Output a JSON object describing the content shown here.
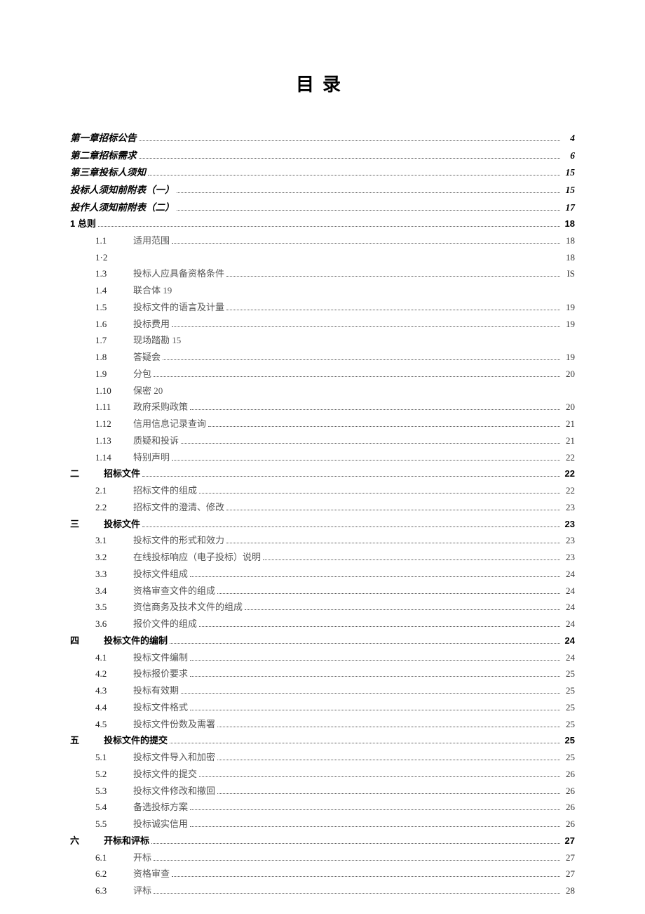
{
  "title": "目录",
  "entries": [
    {
      "level": 0,
      "style": "italic",
      "num": "",
      "label": "第一章招标公告",
      "page": "4",
      "dots": true
    },
    {
      "level": 0,
      "style": "italic",
      "num": "",
      "label": "第二章招标需求",
      "page": "6",
      "dots": true
    },
    {
      "level": 0,
      "style": "italic",
      "num": "",
      "label": "第三章投标人须知",
      "page": "15",
      "dots": true
    },
    {
      "level": 0,
      "style": "italic",
      "num": "",
      "label": "投标人须知前附表（一）",
      "page": "15",
      "dots": true
    },
    {
      "level": 0,
      "style": "italic",
      "num": "",
      "label": "投作人须知前附表（二）",
      "page": "17",
      "dots": true
    },
    {
      "level": 0,
      "style": "bold",
      "num": "",
      "label": "1 总则",
      "page": "18",
      "dots": true
    },
    {
      "level": 2,
      "num": "1.1",
      "label": "适用范围",
      "page": "18",
      "dots": true
    },
    {
      "level": 2,
      "num": "1·2",
      "label": "",
      "page": "18",
      "dots": false,
      "pageRight": true
    },
    {
      "level": 2,
      "num": "1.3",
      "label": "投标人应具备资格条件",
      "page": "IS",
      "dots": true
    },
    {
      "level": 2,
      "num": "1.4",
      "label": "联合体 19",
      "page": "",
      "dots": false
    },
    {
      "level": 2,
      "num": "1.5",
      "label": "投标文件的语言及计量",
      "page": "19",
      "dots": true
    },
    {
      "level": 2,
      "num": "1.6",
      "label": "投标费用",
      "page": "19",
      "dots": true
    },
    {
      "level": 2,
      "num": "1.7",
      "label": "现场踏勘 15",
      "page": "",
      "dots": false
    },
    {
      "level": 2,
      "num": "1.8",
      "label": "答疑会",
      "page": "19",
      "dots": true
    },
    {
      "level": 2,
      "num": "1.9",
      "label": "分包",
      "page": "20",
      "dots": true
    },
    {
      "level": 2,
      "num": "1.10",
      "label": "保密 20",
      "page": "",
      "dots": false
    },
    {
      "level": 2,
      "num": "1.11",
      "label": "政府采购政策",
      "page": "20",
      "dots": true
    },
    {
      "level": 2,
      "num": "1.12",
      "label": "信用信息记录查询",
      "page": "21",
      "dots": true
    },
    {
      "level": 2,
      "num": "1.13",
      "label": "质疑和投诉",
      "page": "21",
      "dots": true
    },
    {
      "level": 2,
      "num": "1.14",
      "label": "特别声明",
      "page": "22",
      "dots": true
    },
    {
      "level": 1,
      "style": "bold",
      "num": "二",
      "label": "招标文件",
      "page": "22",
      "dots": true
    },
    {
      "level": 2,
      "num": "2.1",
      "label": "招标文件的组成",
      "page": "22",
      "dots": true
    },
    {
      "level": 2,
      "num": "2.2",
      "label": "招标文件的澄清、修改",
      "page": "23",
      "dots": true
    },
    {
      "level": 1,
      "style": "bold",
      "num": "三",
      "label": "投标文件",
      "page": "23",
      "dots": true
    },
    {
      "level": 2,
      "num": "3.1",
      "label": "投标文件的形式和效力",
      "page": "23",
      "dots": true
    },
    {
      "level": 2,
      "num": "3.2",
      "label": "在线投标响应（电子投标）说明",
      "page": "23",
      "dots": true
    },
    {
      "level": 2,
      "num": "3.3",
      "label": "投标文件组成",
      "page": "24",
      "dots": true
    },
    {
      "level": 2,
      "num": "3.4",
      "label": "资格审查文件的组成",
      "page": "24",
      "dots": true
    },
    {
      "level": 2,
      "num": "3.5",
      "label": "资信商务及技术文件的组成",
      "page": "24",
      "dots": true
    },
    {
      "level": 2,
      "num": "3.6",
      "label": "报价文件的组成",
      "page": "24",
      "dots": true
    },
    {
      "level": 1,
      "style": "bold",
      "num": "四",
      "label": "投标文件的编制",
      "page": "24",
      "dots": true
    },
    {
      "level": 2,
      "num": "4.1",
      "label": "投标文件编制",
      "page": "24",
      "dots": true
    },
    {
      "level": 2,
      "num": "4.2",
      "label": "投标报价要求",
      "page": "25",
      "dots": true
    },
    {
      "level": 2,
      "num": "4.3",
      "label": "投标有效期",
      "page": "25",
      "dots": true
    },
    {
      "level": 2,
      "num": "4.4",
      "label": "投标文件格式",
      "page": "25",
      "dots": true
    },
    {
      "level": 2,
      "num": "4.5",
      "label": "投标文件份数及需署",
      "page": "25",
      "dots": true
    },
    {
      "level": 1,
      "style": "bold",
      "num": "五",
      "label": "投标文件的提交",
      "page": "25",
      "dots": true
    },
    {
      "level": 2,
      "num": "5.1",
      "label": "投标文件导入和加密",
      "page": "25",
      "dots": true
    },
    {
      "level": 2,
      "num": "5.2",
      "label": "投标文件的提交",
      "page": "26",
      "dots": true
    },
    {
      "level": 2,
      "num": "5.3",
      "label": "投标文件修改和撤回",
      "page": "26",
      "dots": true
    },
    {
      "level": 2,
      "num": "5.4",
      "label": "备选投标方案",
      "page": "26",
      "dots": true
    },
    {
      "level": 2,
      "num": "5.5",
      "label": "投标诚实信用",
      "page": "26",
      "dots": true
    },
    {
      "level": 1,
      "style": "bold",
      "num": "六",
      "label": "开标和评标",
      "page": "27",
      "dots": true
    },
    {
      "level": 2,
      "num": "6.1",
      "label": "开标",
      "page": "27",
      "dots": true
    },
    {
      "level": 2,
      "num": "6.2",
      "label": "资格审查",
      "page": "27",
      "dots": true
    },
    {
      "level": 2,
      "num": "6.3",
      "label": "评标",
      "page": "28",
      "dots": true
    }
  ]
}
